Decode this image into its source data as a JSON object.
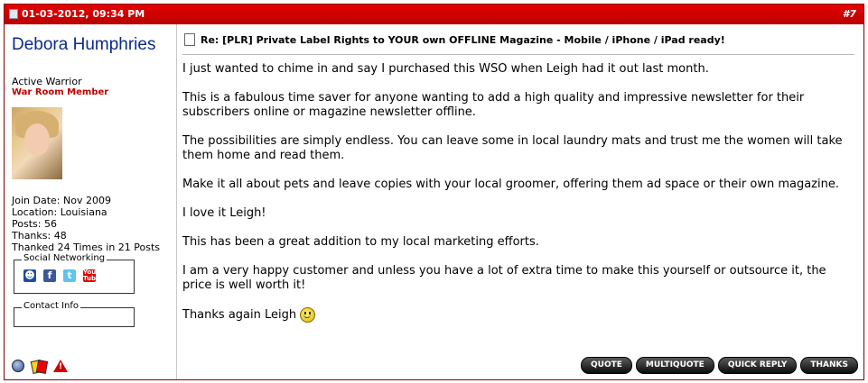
{
  "header": {
    "date": "01-03-2012, 09:34 PM",
    "post_number": "#7"
  },
  "user": {
    "name": "Debora Humphries",
    "title": "Active Warrior",
    "rank": "War Room Member",
    "stats": [
      "Join Date: Nov 2009",
      "Location: Louisiana",
      "Posts: 56",
      "Thanks: 48",
      "Thanked 24 Times in 21 Posts"
    ],
    "social_label": "Social Networking",
    "social_icons": [
      "myspace-icon",
      "facebook-icon",
      "twitter-icon",
      "youtube-icon"
    ],
    "contact_label": "Contact Info"
  },
  "post": {
    "title": "Re: [PLR] Private Label Rights to YOUR own OFFLINE Magazine - Mobile / iPhone / iPad ready!",
    "paragraphs": [
      "I just wanted to chime in and say I purchased this WSO when Leigh had it out last month.",
      "This is a fabulous time saver for anyone wanting to add a high quality and impressive newsletter for their subscribers online or magazine newsletter offline.",
      "The possibilities are simply endless. You can leave some in local laundry mats and trust me the women will take them home and read them.",
      "Make it all about pets and leave copies with your local groomer, offering them ad space or their own magazine.",
      "I love it Leigh!",
      "This has been a great addition to my local marketing efforts.",
      "I am a very happy customer and unless you have a lot of extra time to make this yourself or outsource it, the price is well worth it!",
      "Thanks again Leigh"
    ]
  },
  "buttons": {
    "quote": "QUOTE",
    "multiquote": "MULTIQUOTE",
    "quick_reply": "QUICK REPLY",
    "thanks": "THANKS"
  },
  "colors": {
    "header_red": "#cc0000",
    "username_blue": "#0b2a8a",
    "rank_red": "#c00000"
  }
}
